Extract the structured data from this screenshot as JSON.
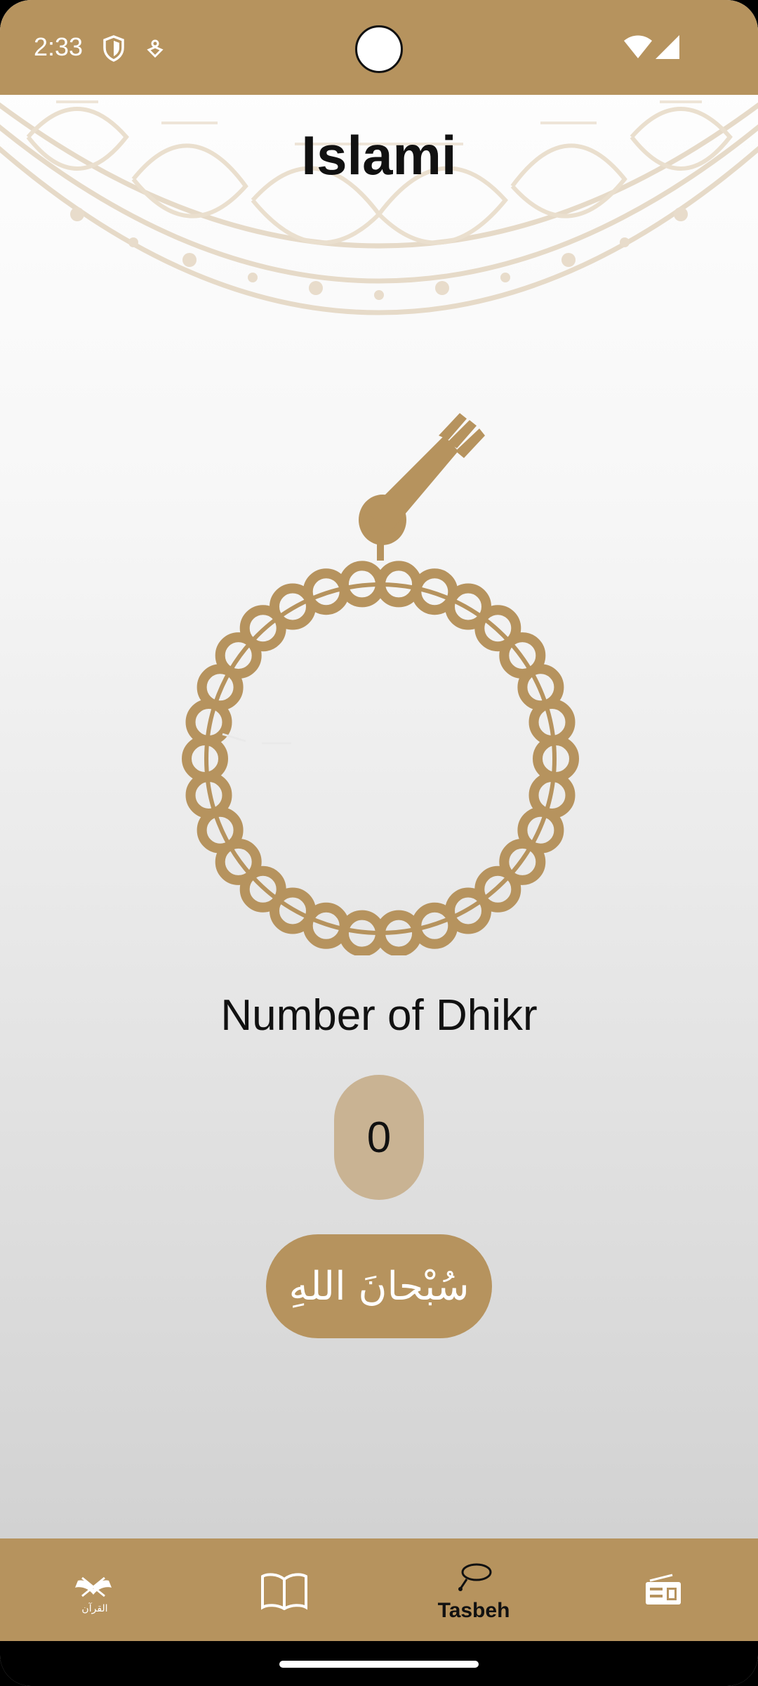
{
  "status_bar": {
    "time": "2:33",
    "icons": [
      "shield-icon",
      "location-pin-icon",
      "wifi-icon",
      "cellular-signal-icon"
    ]
  },
  "header": {
    "title": "Islami"
  },
  "tasbeh": {
    "label": "Number of Dhikr",
    "count": "0",
    "dhikr_text": "سُبْحانَ اللهِ"
  },
  "bottom_nav": {
    "items": [
      {
        "id": "quran",
        "icon": "quran-icon",
        "icon_text": "القرآن",
        "label": "",
        "selected": false
      },
      {
        "id": "hadeth",
        "icon": "open-book-icon",
        "label": "",
        "selected": false
      },
      {
        "id": "tasbeh",
        "icon": "sebha-icon",
        "label": "Tasbeh",
        "selected": true
      },
      {
        "id": "radio",
        "icon": "radio-icon",
        "label": "",
        "selected": false
      }
    ]
  },
  "colors": {
    "accent": "#b6935e",
    "counter_bg": "#c9b393",
    "mandala": "#e3d7c4",
    "text": "#111111"
  }
}
